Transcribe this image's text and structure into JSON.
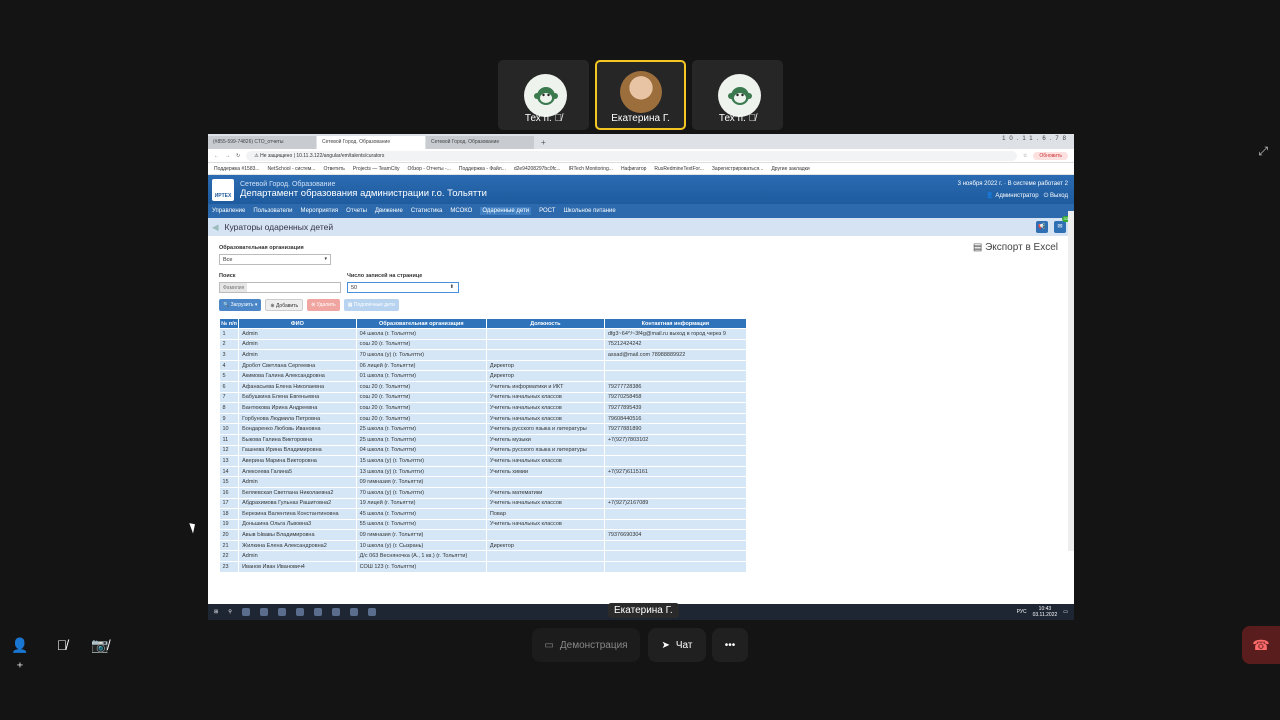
{
  "participants": [
    {
      "name": "Тех п.",
      "muted": true
    },
    {
      "name": "Екатерина Г.",
      "muted": false
    },
    {
      "name": "Тех п.",
      "muted": true
    }
  ],
  "browser": {
    "tabs": [
      "(#855-599-74826) СТО_отчеты",
      "Сетевой Город. Образование",
      "Сетевой Город. Образование"
    ],
    "new_tab": "+",
    "url_prefix": "Не защищено",
    "url": "10.11.3.122/angular/em/talents/curators",
    "refresh_button": "Обновить",
    "bookmarks": [
      "Поддержка #1583...",
      "NetSchool - систем...",
      "Ответить",
      "Projects — TeamCity",
      "Обзор - Отчеты -...",
      "Поддержка - Файл...",
      "d2e94208297bc0fc...",
      "IRTech Monitoring...",
      "Нафигатор",
      "RusRedmineTextFor...",
      "Зарегистрироваться...",
      "Другие закладки"
    ],
    "remote_ip": "10.11.6.78"
  },
  "app": {
    "subtitle": "Сетевой Город. Образование",
    "title": "Департамент образования администрации г.о. Тольятти",
    "logo_text": "ИРТЕХ",
    "status": "3 ноября 2022 г. · В системе работает 2",
    "user": "Администратор",
    "logout": "Выход",
    "nav": [
      "Управление",
      "Пользователи",
      "Мероприятия",
      "Отчеты",
      "Движение",
      "Статистика",
      "МСОКО",
      "Одаренные дети",
      "РОСТ",
      "Школьное питание"
    ],
    "nav_active": "Одаренные дети",
    "page_title": "Кураторы одаренных детей",
    "notif_badge": "33"
  },
  "filters": {
    "org_label": "Образовательная организация",
    "org_value": "Все",
    "search_label": "Поиск",
    "search_placeholder": "Фамилия",
    "per_page_label": "Число записей на странице",
    "per_page_value": "50",
    "export_label": "Экспорт в Excel"
  },
  "buttons": {
    "load": "Загрузить",
    "add": "Добавить",
    "delete": "Удалить",
    "gifted": "Подопечные дети"
  },
  "table": {
    "columns": [
      "№ п/п",
      "ФИО",
      "Образовательная организация",
      "Должность",
      "Контактная информация"
    ],
    "rows": [
      [
        "1",
        "Admin",
        "04 школа (г. Тольятти)",
        "",
        "dfg3~64^/~3f4g@mail.ru выход в город через 9"
      ],
      [
        "2",
        "Admin",
        "сош 20 (г. Тольятти)",
        "",
        "75212424242"
      ],
      [
        "3",
        "Admin",
        "70 школа (у) (г. Тольятти)",
        "",
        "assad@mail.com 78988889922"
      ],
      [
        "4",
        "Дробот Светлана Сергеевна",
        "06 лицей (г. Тольятти)",
        "Директор",
        ""
      ],
      [
        "5",
        "Акимова Галина Александровна",
        "01 школа (г. Тольятти)",
        "Директор",
        ""
      ],
      [
        "6",
        "Афанасьева Елена Николаевна",
        "сош 20 (г. Тольятти)",
        "Учитель информатики и ИКТ",
        "79277728386"
      ],
      [
        "7",
        "Бабушкина Елена Евгеньевна",
        "сош 20 (г. Тольятти)",
        "Учитель начальных классов",
        "79270258458"
      ],
      [
        "8",
        "Бантюкова Ирина Андреевна",
        "сош 20 (г. Тольятти)",
        "Учитель начальных классов",
        "79277895439"
      ],
      [
        "9",
        "Горбунова Людмила Петровна",
        "сош 20 (г. Тольятти)",
        "Учитель начальных классов",
        "79608440516"
      ],
      [
        "10",
        "Бондаренко Любовь Ивановна",
        "25 школа (г. Тольятти)",
        "Учитель русского языка и литературы",
        "79277881890"
      ],
      [
        "11",
        "Быкова Галина Викторовна",
        "25 школа (г. Тольятти)",
        "Учитель музыки",
        "+7(927)7803102"
      ],
      [
        "12",
        "Гашнева Ирина Владимировна",
        "04 школа (г. Тольятти)",
        "Учитель русского языка и литературы",
        ""
      ],
      [
        "13",
        "Аверина Марина Викторовна",
        "15 школа (у) (г. Тольятти)",
        "Учитель начальных классов",
        ""
      ],
      [
        "14",
        "Алексеева Галина5",
        "13 школа (у) (г. Тольятти)",
        "Учитель химии",
        "+7(927)6115161"
      ],
      [
        "15",
        "Admin",
        "09 гимназия (г. Тольятти)",
        "",
        ""
      ],
      [
        "16",
        "Беляевская Светлана Николаевна2",
        "70 школа (у) (г. Тольятти)",
        "Учитель математики",
        ""
      ],
      [
        "17",
        "Абдрахимова Гульназ Рашитовна2",
        "19 лицей (г. Тольятти)",
        "Учитель начальных классов",
        "+7(927)2167089"
      ],
      [
        "18",
        "Березина Валентина Константиновна",
        "45 школа (г. Тольятти)",
        "Повар",
        ""
      ],
      [
        "19",
        "Доньшина Ольга Львовна3",
        "55 школа (г. Тольятти)",
        "Учитель начальных классов",
        ""
      ],
      [
        "20",
        "Авыв Ывавы Владимировна",
        "09 гимназия (г. Тольятти)",
        "",
        "79376690304"
      ],
      [
        "21",
        "Жилкина Елена Александровна2",
        "10 школа (у) (г. Сызрань)",
        "Директор",
        ""
      ],
      [
        "22",
        "Admin",
        "Д/с 063 Весняночка (А., 1 кв.) (г. Тольятти)",
        "",
        ""
      ],
      [
        "23",
        "Иванов Иван Иванович4",
        "СОШ 123 (г. Тольятти)",
        "",
        ""
      ]
    ]
  },
  "taskbar": {
    "lang": "РУС",
    "time": "10:43",
    "date": "03.11.2022"
  },
  "presenter_label": "Екатерина Г.",
  "controls": {
    "share": "Демонстрация",
    "chat": "Чат"
  }
}
